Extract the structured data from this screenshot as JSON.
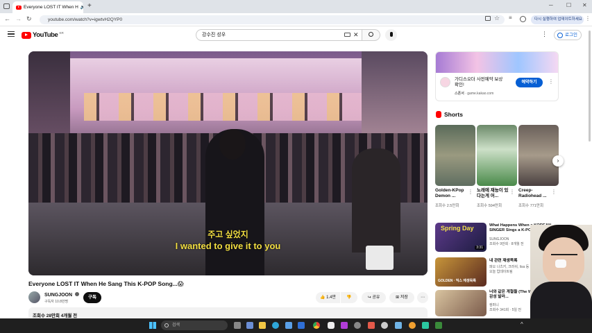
{
  "browser": {
    "tab_title": "Everyone LOST IT When H",
    "url": "youtube.com/watch?v=igwtvH2QYP0",
    "update_button": "다시 실행하여 업데이트하세요"
  },
  "header": {
    "logo": "YouTube",
    "logo_region": "KR",
    "search_value": "강수진 성우",
    "login_label": "로그인"
  },
  "video": {
    "subtitle_korean": "주고 싶었지",
    "subtitle_english": "I wanted to give it to you",
    "title": "Everyone LOST IT When He Sang This K-POP Song...😱",
    "channel": "SUNGJOON",
    "subscribers": "구독자 10.8만명",
    "subscribe_label": "구독",
    "likes": "1.4만",
    "share_label": "공유",
    "save_label": "저장",
    "description_meta": "조회수 28만회  4개월 전"
  },
  "ad": {
    "title": "가디스오더 사전예약 보상 확인!",
    "sponsor": "스폰서",
    "domain": "game.kakao.com",
    "cta": "예약하기"
  },
  "shorts": {
    "header": "Shorts",
    "items": [
      {
        "title": "Golden-KPop Demon ...",
        "views": "조회수 2.5만회"
      },
      {
        "title": "노래에 재능이 있다는게 어...",
        "views": "조회수 594만회"
      },
      {
        "title": "Creep-Radiohead ...",
        "views": "조회수 771만회"
      }
    ]
  },
  "related": [
    {
      "title": "What Happens When a KOREAN SINGER Sings a K-POP So...",
      "channel": "SUNGJOON",
      "meta": "조회수 9만회 · 8개월 전",
      "duration": "3:31",
      "thumb_text": "Spring Day"
    },
    {
      "title": "내 관련 재생목록",
      "channel": "파오 나츠키, 크러쉬, lisa 등",
      "meta": "오늘 업데이트됨",
      "duration": "",
      "thumb_text": "GOLDEN · 믹스 재생목록"
    },
    {
      "title": "너와 같은 계절들 (The We Walked) | 감성 발라...",
      "channel": "컴퍼니",
      "meta": "조회수 341회 · 5일 전",
      "duration": "",
      "thumb_text": ""
    }
  ],
  "taskbar": {
    "search_placeholder": "검색"
  },
  "colors": {
    "youtube_red": "#ff0000",
    "link_blue": "#065fd4",
    "subtitle_yellow": "#f3df42",
    "ad_button": "#065fd4",
    "taskbar": "#1f1f1f"
  }
}
